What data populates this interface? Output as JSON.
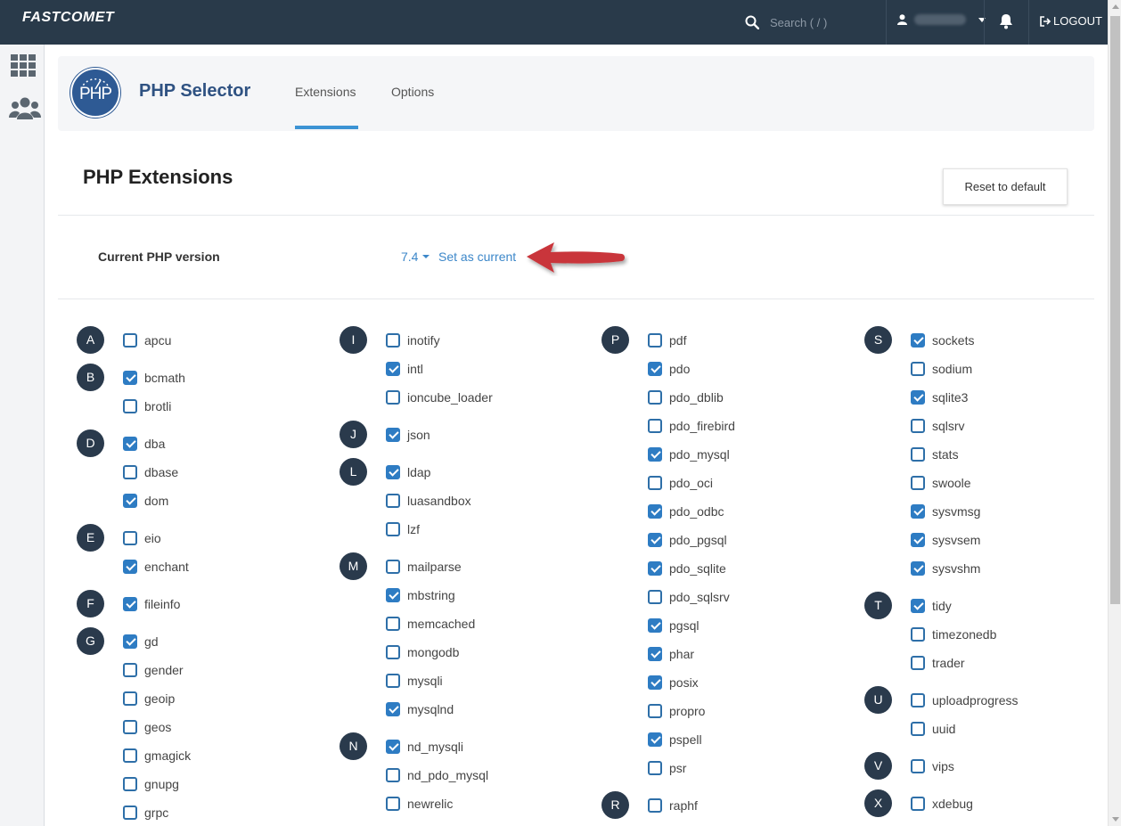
{
  "topbar": {
    "logo": "FASTCOMET",
    "search_placeholder": "Search ( / )",
    "logout_label": "LOGOUT"
  },
  "app": {
    "title": "PHP Selector",
    "logo_text": "PHP",
    "tabs": [
      {
        "label": "Extensions",
        "active": true
      },
      {
        "label": "Options",
        "active": false
      }
    ]
  },
  "page": {
    "heading": "PHP Extensions",
    "reset_label": "Reset to default",
    "current_label": "Current PHP version",
    "version": "7.4",
    "set_current_label": "Set as current"
  },
  "colors": {
    "topbar": "#293a4a",
    "accent": "#3c93d4",
    "checkbox": "#2e7cc3",
    "arrow": "#c9363b"
  },
  "letters": [
    "A",
    "B",
    "D",
    "E",
    "F",
    "G",
    "I",
    "J",
    "L",
    "M",
    "N",
    "P",
    "R",
    "S",
    "T",
    "U",
    "V",
    "X"
  ],
  "extensions": [
    {
      "name": "apcu",
      "checked": false
    },
    {
      "name": "bcmath",
      "checked": true
    },
    {
      "name": "brotli",
      "checked": false
    },
    {
      "name": "dba",
      "checked": true
    },
    {
      "name": "dbase",
      "checked": false
    },
    {
      "name": "dom",
      "checked": true
    },
    {
      "name": "eio",
      "checked": false
    },
    {
      "name": "enchant",
      "checked": true
    },
    {
      "name": "fileinfo",
      "checked": true
    },
    {
      "name": "gd",
      "checked": true
    },
    {
      "name": "gender",
      "checked": false
    },
    {
      "name": "geoip",
      "checked": false
    },
    {
      "name": "geos",
      "checked": false
    },
    {
      "name": "gmagick",
      "checked": false
    },
    {
      "name": "gnupg",
      "checked": false
    },
    {
      "name": "grpc",
      "checked": false
    },
    {
      "name": "inotify",
      "checked": false
    },
    {
      "name": "intl",
      "checked": true
    },
    {
      "name": "ioncube_loader",
      "checked": false
    },
    {
      "name": "json",
      "checked": true
    },
    {
      "name": "ldap",
      "checked": true
    },
    {
      "name": "luasandbox",
      "checked": false
    },
    {
      "name": "lzf",
      "checked": false
    },
    {
      "name": "mailparse",
      "checked": false
    },
    {
      "name": "mbstring",
      "checked": true
    },
    {
      "name": "memcached",
      "checked": false
    },
    {
      "name": "mongodb",
      "checked": false
    },
    {
      "name": "mysqli",
      "checked": false
    },
    {
      "name": "mysqlnd",
      "checked": true
    },
    {
      "name": "nd_mysqli",
      "checked": true
    },
    {
      "name": "nd_pdo_mysql",
      "checked": false
    },
    {
      "name": "newrelic",
      "checked": false
    },
    {
      "name": "pdf",
      "checked": false
    },
    {
      "name": "pdo",
      "checked": true
    },
    {
      "name": "pdo_dblib",
      "checked": false
    },
    {
      "name": "pdo_firebird",
      "checked": false
    },
    {
      "name": "pdo_mysql",
      "checked": true
    },
    {
      "name": "pdo_oci",
      "checked": false
    },
    {
      "name": "pdo_odbc",
      "checked": true
    },
    {
      "name": "pdo_pgsql",
      "checked": true
    },
    {
      "name": "pdo_sqlite",
      "checked": true
    },
    {
      "name": "pdo_sqlsrv",
      "checked": false
    },
    {
      "name": "pgsql",
      "checked": true
    },
    {
      "name": "phar",
      "checked": true
    },
    {
      "name": "posix",
      "checked": true
    },
    {
      "name": "propro",
      "checked": false
    },
    {
      "name": "pspell",
      "checked": true
    },
    {
      "name": "psr",
      "checked": false
    },
    {
      "name": "raphf",
      "checked": false
    },
    {
      "name": "sockets",
      "checked": true
    },
    {
      "name": "sodium",
      "checked": false
    },
    {
      "name": "sqlite3",
      "checked": true
    },
    {
      "name": "sqlsrv",
      "checked": false
    },
    {
      "name": "stats",
      "checked": false
    },
    {
      "name": "swoole",
      "checked": false
    },
    {
      "name": "sysvmsg",
      "checked": true
    },
    {
      "name": "sysvsem",
      "checked": true
    },
    {
      "name": "sysvshm",
      "checked": true
    },
    {
      "name": "tidy",
      "checked": true
    },
    {
      "name": "timezonedb",
      "checked": false
    },
    {
      "name": "trader",
      "checked": false
    },
    {
      "name": "uploadprogress",
      "checked": false
    },
    {
      "name": "uuid",
      "checked": false
    },
    {
      "name": "vips",
      "checked": false
    },
    {
      "name": "xdebug",
      "checked": false
    }
  ]
}
